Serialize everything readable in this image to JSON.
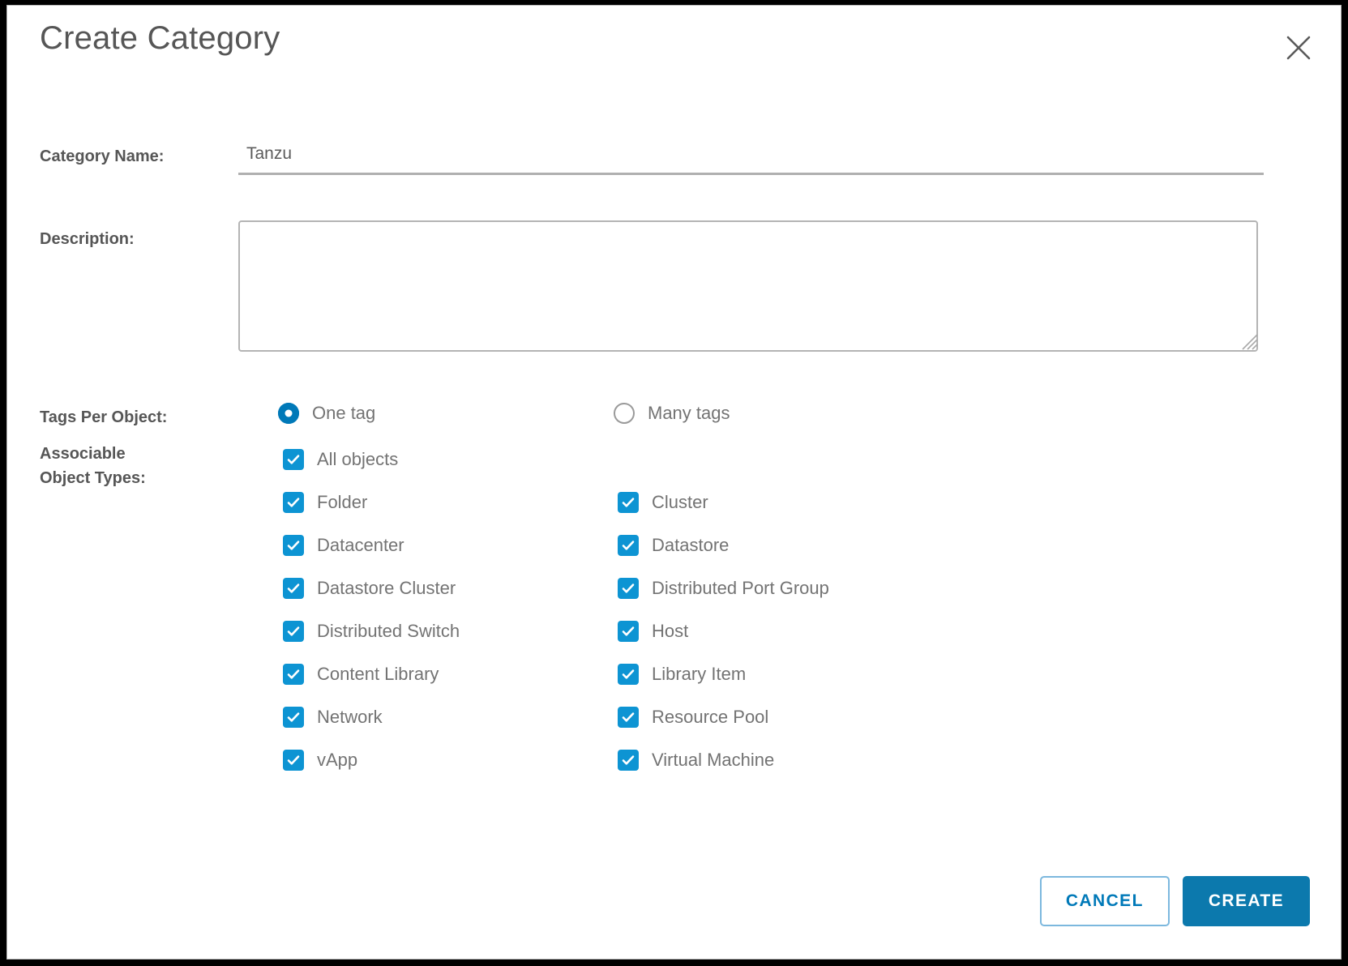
{
  "dialog": {
    "title": "Create Category",
    "close_icon": "close-icon",
    "accent_blue": "#0079b8",
    "checkbox_blue": "#0d94d3",
    "label_color": "#565656",
    "value_color": "#737373"
  },
  "fields": {
    "category_name": {
      "label": "Category Name:",
      "value": "Tanzu",
      "placeholder": ""
    },
    "description": {
      "label": "Description:",
      "value": "",
      "placeholder": ""
    },
    "tags_per_object": {
      "label": "Tags Per Object:",
      "selected": "One tag",
      "options": [
        {
          "label": "One tag",
          "checked": true
        },
        {
          "label": "Many tags",
          "checked": false
        }
      ]
    },
    "associable_object_types": {
      "label_line_1": "Associable",
      "label_line_2": "Object Types:",
      "all_objects": {
        "label": "All objects",
        "checked": true
      },
      "column_left": [
        {
          "label": "Folder",
          "checked": true
        },
        {
          "label": "Datacenter",
          "checked": true
        },
        {
          "label": "Datastore Cluster",
          "checked": true
        },
        {
          "label": "Distributed Switch",
          "checked": true
        },
        {
          "label": "Content Library",
          "checked": true
        },
        {
          "label": "Network",
          "checked": true
        },
        {
          "label": "vApp",
          "checked": true
        }
      ],
      "column_right": [
        {
          "label": "Cluster",
          "checked": true
        },
        {
          "label": "Datastore",
          "checked": true
        },
        {
          "label": "Distributed Port Group",
          "checked": true
        },
        {
          "label": "Host",
          "checked": true
        },
        {
          "label": "Library Item",
          "checked": true
        },
        {
          "label": "Resource Pool",
          "checked": true
        },
        {
          "label": "Virtual Machine",
          "checked": true
        }
      ]
    }
  },
  "footer": {
    "cancel_label": "CANCEL",
    "create_label": "CREATE"
  }
}
